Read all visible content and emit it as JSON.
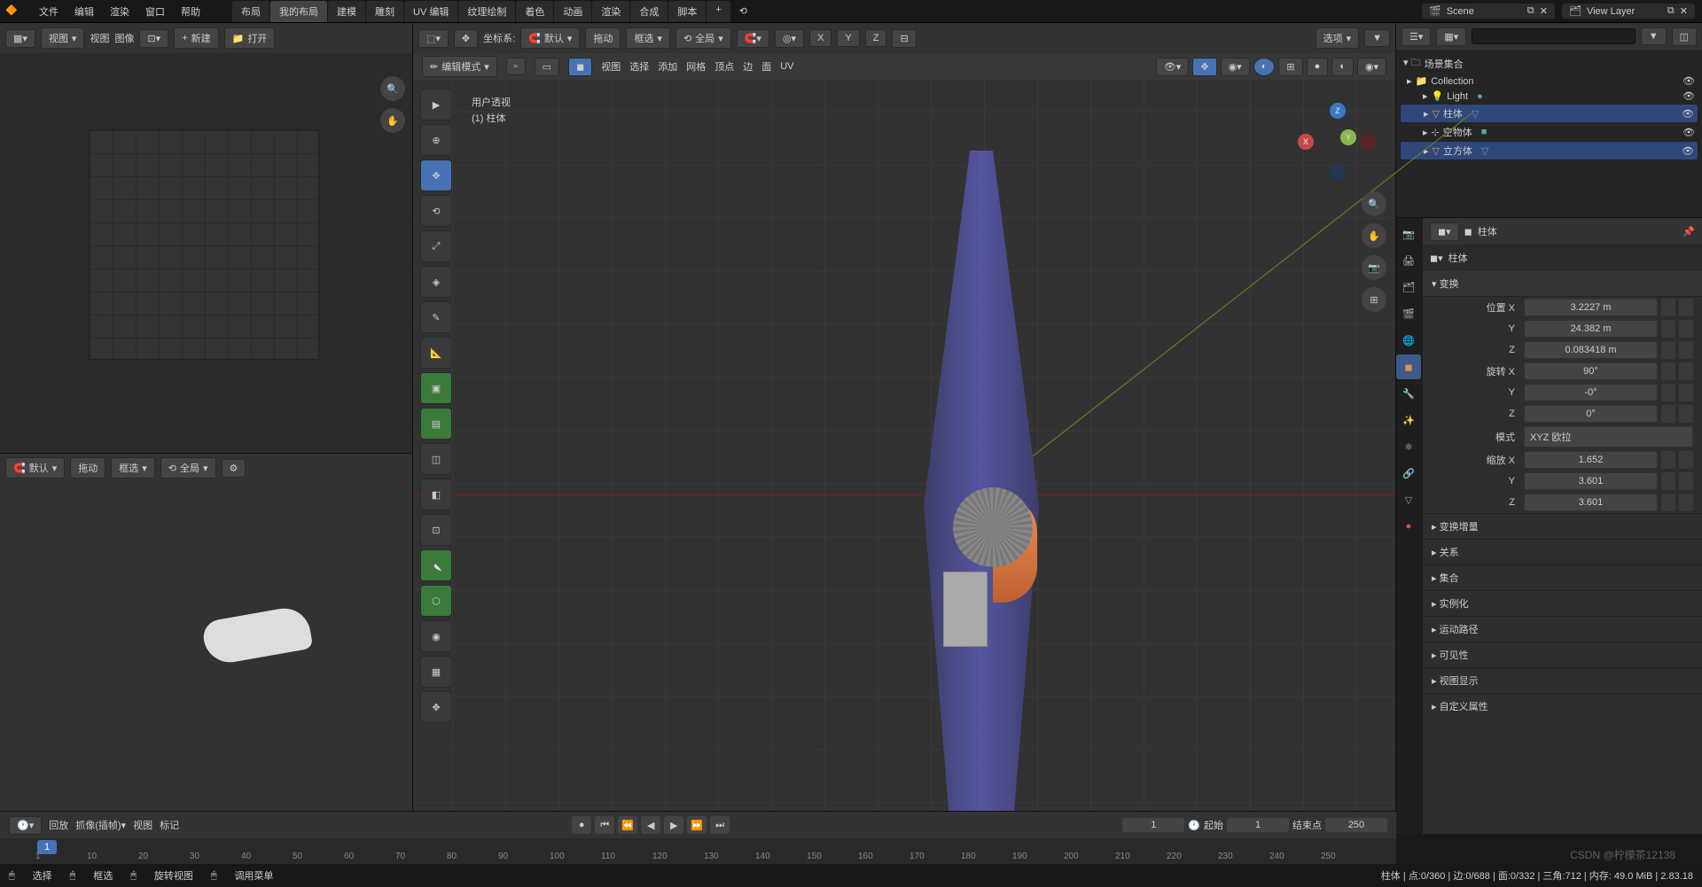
{
  "top_menu": [
    "文件",
    "编辑",
    "渲染",
    "窗口",
    "帮助"
  ],
  "workspace_tabs": [
    "布局",
    "我的布局",
    "建模",
    "雕刻",
    "UV 编辑",
    "纹理绘制",
    "着色",
    "动画",
    "渲染",
    "合成",
    "脚本"
  ],
  "active_tab": "我的布局",
  "scene_name": "Scene",
  "view_layer": "View Layer",
  "uv_header": {
    "view_label": "视图",
    "menu": [
      "视图",
      "图像"
    ],
    "new": "新建",
    "open": "打开"
  },
  "secondary_header": {
    "default": "默认",
    "drag": "拖动",
    "box": "框选",
    "global": "全局"
  },
  "vp_header": {
    "coord": "坐标系:",
    "default": "默认",
    "drag": "拖动",
    "box": "框选",
    "global": "全局",
    "options": "选项"
  },
  "vp_header2": {
    "mode": "编辑模式",
    "menus": [
      "视图",
      "选择",
      "添加",
      "网格",
      "顶点",
      "边",
      "面",
      "UV"
    ]
  },
  "overlay": {
    "line1": "用户透视",
    "line2": "(1) 柱体"
  },
  "outliner": {
    "title": "场景集合",
    "items": [
      {
        "icon": "📁",
        "name": "Collection",
        "sel": false,
        "indent": 0
      },
      {
        "icon": "💡",
        "name": "Light",
        "sel": false,
        "indent": 1,
        "badge": "●"
      },
      {
        "icon": "▽",
        "name": "柱体",
        "sel": true,
        "indent": 1,
        "badge": "▽",
        "orange": true
      },
      {
        "icon": "⊹",
        "name": "空物体",
        "sel": false,
        "indent": 1,
        "badge": "■"
      },
      {
        "icon": "▽",
        "name": "立方体",
        "sel": true,
        "indent": 1,
        "badge": "▽",
        "orange": true
      }
    ]
  },
  "props": {
    "obj_name": "柱体",
    "data_name": "柱体",
    "transform_title": "变换",
    "location_label": "位置 X",
    "rotation_label": "旋转 X",
    "scale_label": "缩放 X",
    "mode_label": "模式",
    "mode_value": "XYZ 欧拉",
    "loc": {
      "x": "3.2227 m",
      "y": "24.382 m",
      "z": "0.083418 m"
    },
    "rot": {
      "x": "90°",
      "y": "-0°",
      "z": "0°"
    },
    "scale": {
      "x": "1.652",
      "y": "3.601",
      "z": "3.601"
    },
    "panels": [
      "变换增量",
      "关系",
      "集合",
      "实例化",
      "运动路径",
      "可见性",
      "视图显示",
      "自定义属性"
    ]
  },
  "timeline": {
    "playback": "回放",
    "keying": "抓像(插帧)",
    "view": "视图",
    "marker": "标记",
    "current": "1",
    "start_label": "起始",
    "start": "1",
    "end_label": "结束点",
    "end": "250",
    "ticks": [
      1,
      10,
      20,
      30,
      40,
      50,
      60,
      70,
      80,
      90,
      100,
      110,
      120,
      130,
      140,
      150,
      160,
      170,
      180,
      190,
      200,
      210,
      220,
      230,
      240,
      250
    ]
  },
  "status": {
    "left": [
      "选择",
      "框选",
      "旋转视图",
      "调用菜单"
    ],
    "right": "柱体 | 点:0/360 | 边:0/688 | 面:0/332 | 三角:712 | 内存: 49.0 MiB | 2.83.18"
  },
  "watermark": "CSDN @柠檬茶12138",
  "axes": {
    "x": "X",
    "y": "Y",
    "z": "Z"
  }
}
